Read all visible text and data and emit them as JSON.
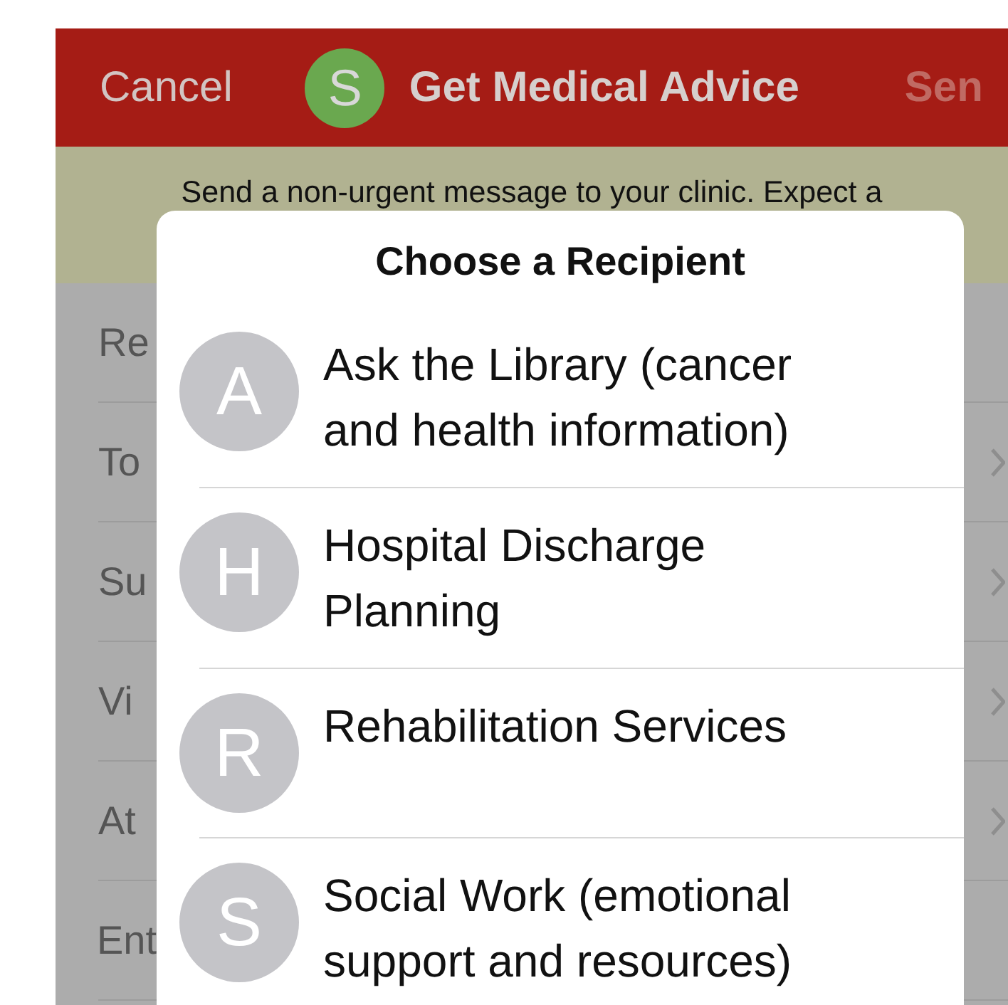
{
  "header": {
    "cancel": "Cancel",
    "avatar_initial": "S",
    "title": "Get Medical Advice",
    "send": "Sen"
  },
  "banner": "Send a non-urgent message to your clinic. Expect a",
  "form_rows": [
    {
      "label": "Re",
      "chevron": false
    },
    {
      "label": "To",
      "chevron": true
    },
    {
      "label": "Su",
      "chevron": true
    },
    {
      "label": "Vi",
      "chevron": true
    },
    {
      "label": "At",
      "chevron": true
    },
    {
      "label": "Ent",
      "chevron": false
    }
  ],
  "dialog": {
    "title": "Choose a Recipient",
    "recipients": [
      {
        "initial": "A",
        "name": "Ask the Library (cancer and health information)"
      },
      {
        "initial": "H",
        "name": "Hospital Discharge Planning"
      },
      {
        "initial": "R",
        "name": "Rehabilitation Services"
      },
      {
        "initial": "S",
        "name": "Social Work (emotional support and resources)"
      }
    ]
  }
}
